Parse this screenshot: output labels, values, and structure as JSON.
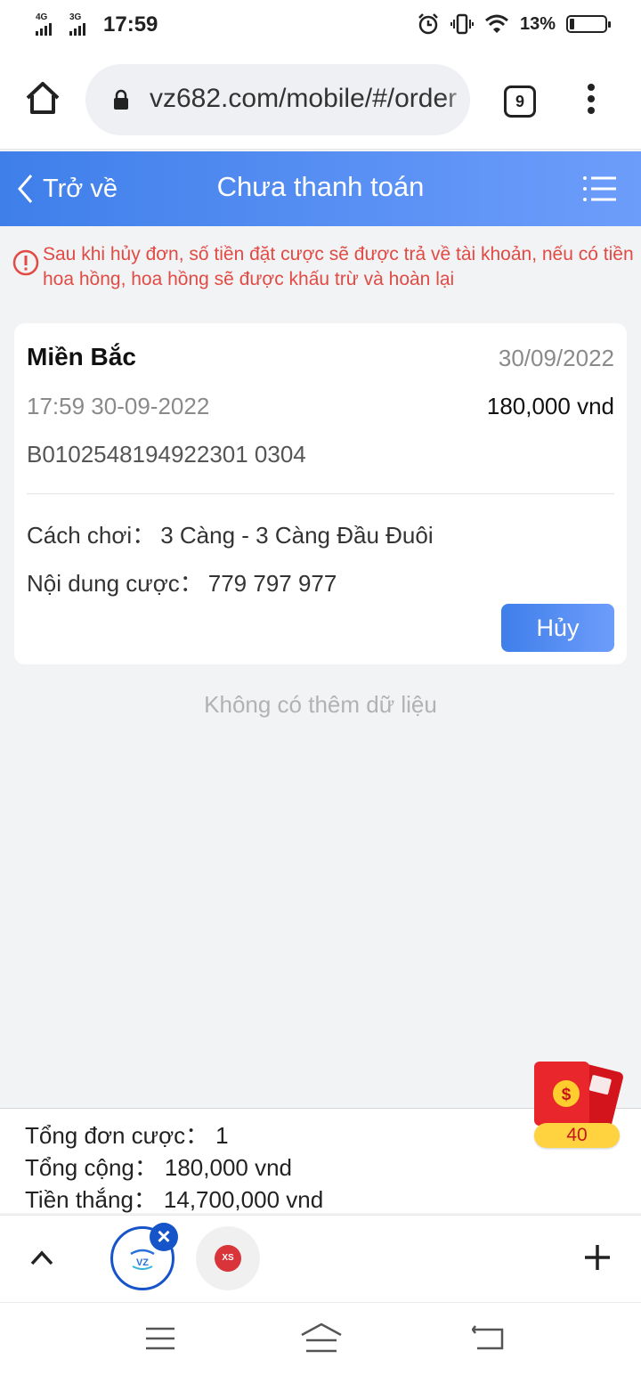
{
  "status_bar": {
    "sim1": "4G",
    "sim2": "3G",
    "time": "17:59",
    "battery": "13%",
    "battery_level": 0.13
  },
  "browser": {
    "url": "vz682.com/mobile/#/order",
    "tab_count": "9"
  },
  "header": {
    "back_label": "Trở về",
    "title": "Chưa thanh toán"
  },
  "notice": {
    "text": "Sau khi hủy đơn, số tiền đặt cược sẽ được trả về tài khoản, nếu có tiền hoa hồng, hoa hồng sẽ được khấu trừ và hoàn lại",
    "color": "#e24a44"
  },
  "order": {
    "region": "Miền Bắc",
    "date": "30/09/2022",
    "time": "17:59 30-09-2022",
    "amount": "180,000 vnd",
    "code": "B0102548194922301 0304",
    "play_label": "Cách chơi：",
    "play_value": "3 Càng - 3 Càng Đầu Đuôi",
    "content_label": "Nội dung cược：",
    "content_value": "779 797 977",
    "cancel_label": "Hủy"
  },
  "no_more": "Không có thêm dữ liệu",
  "summary": {
    "total_orders_label": "Tổng đơn cược：",
    "total_orders_value": "1",
    "total_label": "Tổng cộng：",
    "total_value": "180,000 vnd",
    "winnings_label": "Tiền thắng：",
    "winnings_value": "14,700,000 vnd"
  },
  "red_envelope": {
    "count": "40"
  },
  "tab_strip": {
    "xs_label": "XS"
  },
  "colors": {
    "accent": "#3f7fea",
    "accent_light": "#6d9dfb",
    "warning": "#e24a44",
    "tab_active": "#1554c9"
  }
}
